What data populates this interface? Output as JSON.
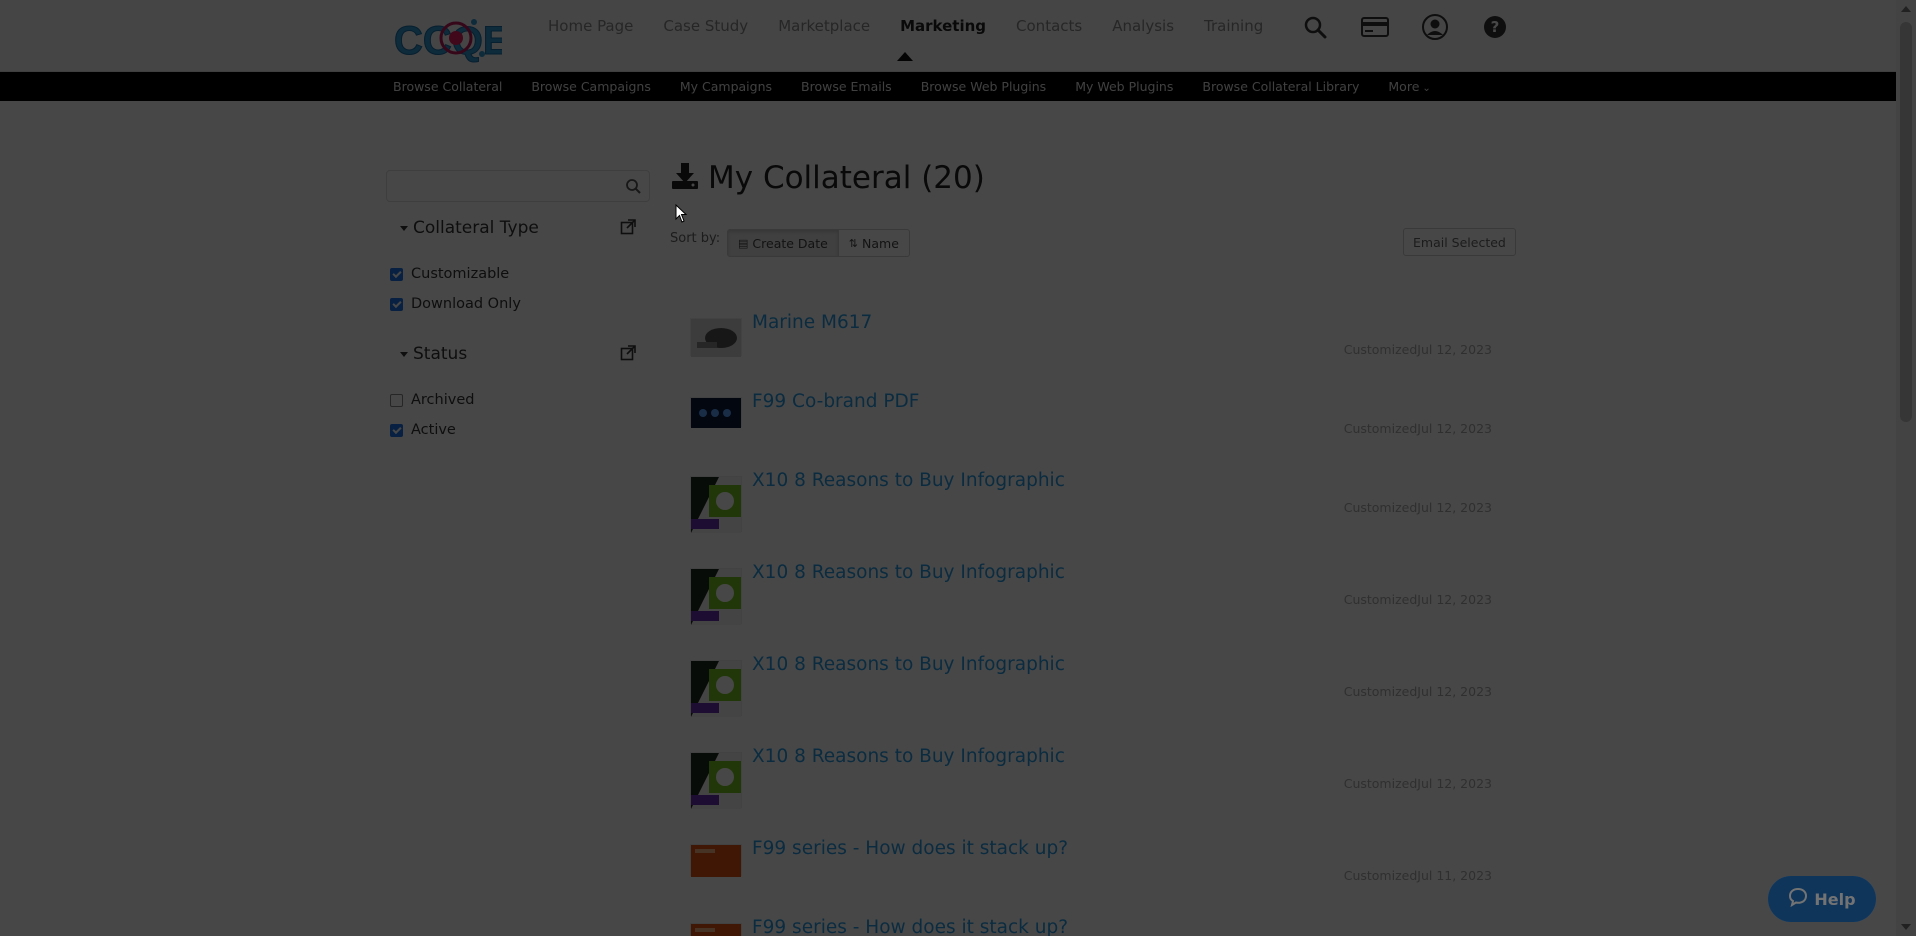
{
  "logo": {
    "text": "CCQE"
  },
  "main_nav": [
    {
      "label": "Home Page",
      "active": false
    },
    {
      "label": "Case Study",
      "active": false
    },
    {
      "label": "Marketplace",
      "active": false
    },
    {
      "label": "Marketing",
      "active": true
    },
    {
      "label": "Contacts",
      "active": false
    },
    {
      "label": "Analysis",
      "active": false
    },
    {
      "label": "Training",
      "active": false
    }
  ],
  "top_icons": [
    "search-icon",
    "credit-card-icon",
    "user-icon",
    "help-icon"
  ],
  "sub_nav": [
    "Browse Collateral",
    "Browse Campaigns",
    "My Campaigns",
    "Browse Emails",
    "Browse Web Plugins",
    "My Web Plugins",
    "Browse Collateral Library"
  ],
  "sub_nav_more": "More",
  "sidebar": {
    "search_placeholder": "",
    "facets": [
      {
        "title": "Collateral Type",
        "options": [
          {
            "label": "Customizable",
            "checked": true
          },
          {
            "label": "Download Only",
            "checked": true
          }
        ]
      },
      {
        "title": "Status",
        "options": [
          {
            "label": "Archived",
            "checked": false
          },
          {
            "label": "Active",
            "checked": true
          }
        ]
      }
    ]
  },
  "main": {
    "title": "My Collateral (20)",
    "sort_label": "Sort by:",
    "sort_create_date": "Create Date",
    "sort_name": "Name",
    "email_selected": "Email Selected"
  },
  "items": [
    {
      "title": "Marine M617",
      "meta": "CustomizedJul 12, 2023",
      "thumb": "dark-photo"
    },
    {
      "title": "F99 Co-brand PDF",
      "meta": "CustomizedJul 12, 2023",
      "thumb": "dark-blue"
    },
    {
      "title": "X10 8 Reasons to Buy Infographic",
      "meta": "CustomizedJul 12, 2023",
      "thumb": "infographic"
    },
    {
      "title": "X10 8 Reasons to Buy Infographic",
      "meta": "CustomizedJul 12, 2023",
      "thumb": "infographic"
    },
    {
      "title": "X10 8 Reasons to Buy Infographic",
      "meta": "CustomizedJul 12, 2023",
      "thumb": "infographic"
    },
    {
      "title": "X10 8 Reasons to Buy Infographic",
      "meta": "CustomizedJul 12, 2023",
      "thumb": "infographic"
    },
    {
      "title": "F99 series - How does it stack up?",
      "meta": "CustomizedJul 11, 2023",
      "thumb": "orange"
    },
    {
      "title": "F99 series - How does it stack up?",
      "meta": "",
      "thumb": "orange"
    }
  ],
  "help": {
    "label": "Help"
  },
  "colors": {
    "link": "#2a9ee6",
    "checkbox": "#1e73e8",
    "help": "#2276c9",
    "overlay": "rgba(0,0,0,0.72)"
  }
}
